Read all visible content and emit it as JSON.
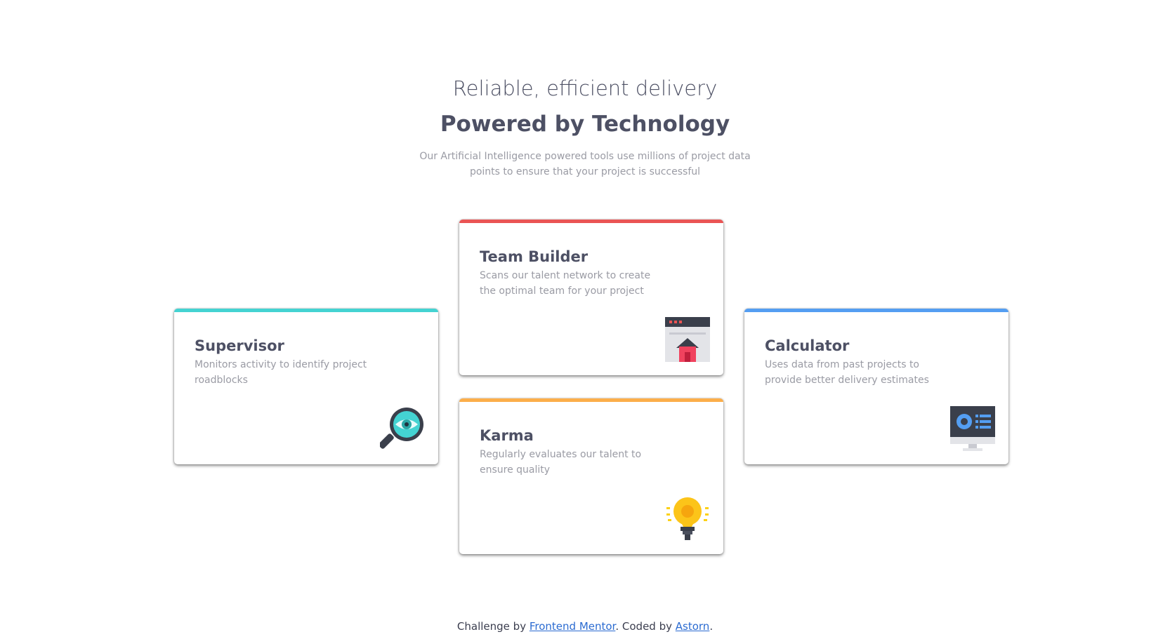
{
  "header": {
    "tagline": "Reliable, efficient delivery",
    "headline": "Powered by Technology",
    "intro": "Our Artificial Intelligence powered tools use millions of project data points to ensure that your project is successful"
  },
  "cards": [
    {
      "title": "Supervisor",
      "description": "Monitors activity to identify project roadblocks",
      "icon": "magnifying-glass-eye-icon",
      "accent": "#44d3d2"
    },
    {
      "title": "Team Builder",
      "description": "Scans our talent network to create the optimal team for your project",
      "icon": "browser-house-icon",
      "accent": "#ea5454"
    },
    {
      "title": "Karma",
      "description": "Regularly evaluates our talent to ensure quality",
      "icon": "lightbulb-icon",
      "accent": "#fcae4a"
    },
    {
      "title": "Calculator",
      "description": "Uses data from past projects to provide better delivery estimates",
      "icon": "monitor-dashboard-icon",
      "accent": "#549ef2"
    }
  ],
  "footer": {
    "prefix": "Challenge by",
    "challenge_link": "Frontend Mentor",
    "middle": ". Coded by",
    "author_link": "Astorn",
    "suffix": "."
  },
  "colors": {
    "heading": "#4d5064",
    "body_text": "#9a9ba4",
    "link": "#2b6bd1"
  }
}
